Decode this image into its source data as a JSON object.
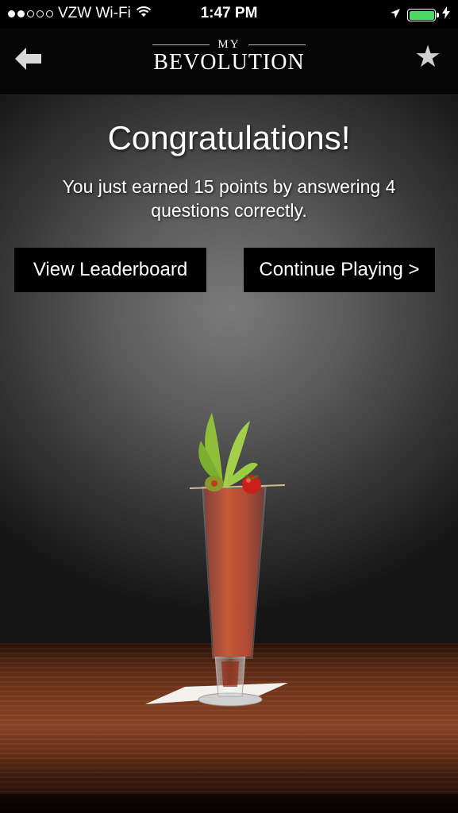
{
  "status_bar": {
    "carrier": "VZW Wi-Fi",
    "time": "1:47 PM",
    "signal_bars_filled": 2,
    "signal_bars_total": 5,
    "battery_color": "#4cd964"
  },
  "nav": {
    "logo_top": "MY",
    "logo_bottom": "BEVOLUTION",
    "back_icon": "back-arrow-icon",
    "favorite_icon": "star-icon"
  },
  "result": {
    "title": "Congratulations!",
    "message": "You just earned 15 points by answering 4 questions correctly."
  },
  "buttons": {
    "leaderboard": "View Leaderboard",
    "continue": "Continue Playing >"
  },
  "colors": {
    "button_bg": "#000000",
    "wood": "#7a3a1e",
    "drink_red": "#b53a1e"
  }
}
